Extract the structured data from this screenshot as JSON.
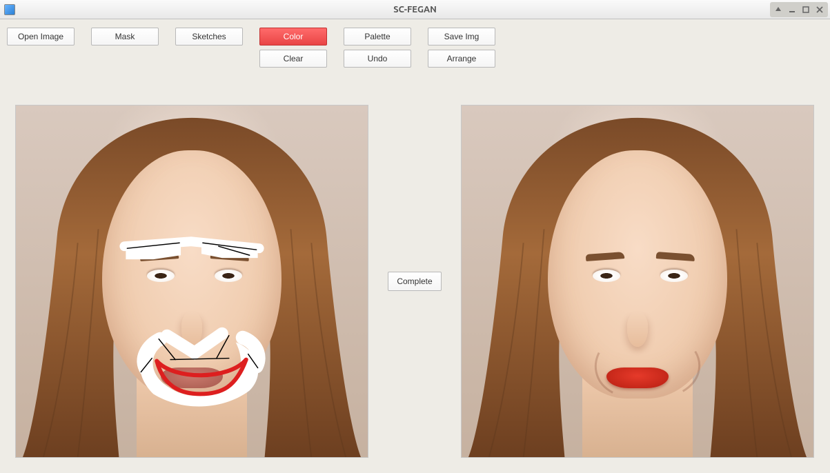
{
  "window": {
    "title": "SC-FEGAN"
  },
  "toolbar": {
    "open_image": "Open Image",
    "mask": "Mask",
    "sketches": "Sketches",
    "color": "Color",
    "clear": "Clear",
    "palette": "Palette",
    "undo": "Undo",
    "save_img": "Save Img",
    "arrange": "Arrange"
  },
  "action": {
    "complete": "Complete"
  },
  "state": {
    "active_tool": "Color"
  }
}
